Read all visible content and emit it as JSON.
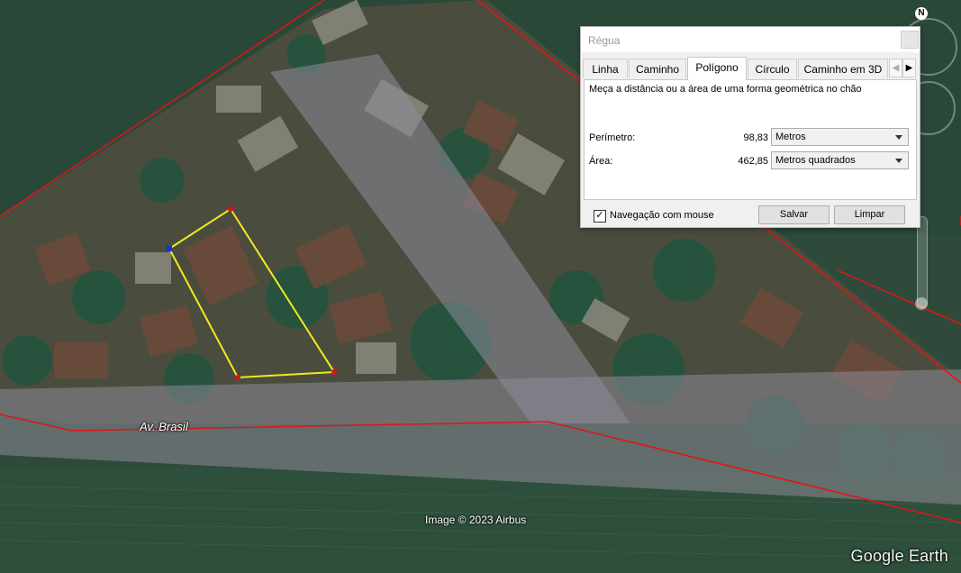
{
  "map": {
    "street_label": "Av. Brasil",
    "copyright": "Image © 2023 Airbus",
    "brand": "Google Earth",
    "compass_letter": "N"
  },
  "ruler_dialog": {
    "title": "Régua",
    "tabs": [
      {
        "label": "Linha"
      },
      {
        "label": "Caminho"
      },
      {
        "label": "Polígono",
        "active": true
      },
      {
        "label": "Círculo"
      },
      {
        "label": "Caminho em 3D"
      }
    ],
    "description": "Meça a distância ou a área de uma forma geométrica no chão",
    "perimeter": {
      "label": "Perímetro:",
      "value": "98,83",
      "unit": "Metros"
    },
    "area": {
      "label": "Área:",
      "value": "462,85",
      "unit": "Metros quadrados"
    },
    "mouse_navigation": {
      "label": "Navegação com mouse",
      "checked": true,
      "check_glyph": "✓"
    },
    "save_label": "Salvar",
    "clear_label": "Limpar"
  },
  "colors": {
    "boundary_line": "#e31414",
    "polygon": "#f2ea1c",
    "vertex": "#e01010",
    "start_vertex": "#1030e0"
  }
}
